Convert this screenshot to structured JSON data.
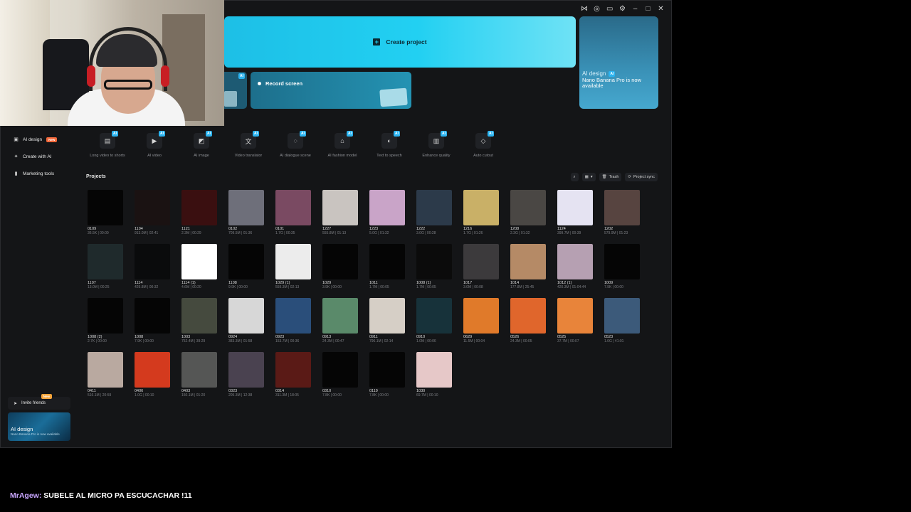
{
  "window_controls": [
    "share-icon",
    "target-icon",
    "screen-icon",
    "settings-icon",
    "minimize-icon",
    "maximize-icon",
    "close-icon"
  ],
  "hero": {
    "create_project": "Create project",
    "record_screen": "Record screen",
    "side_title": "AI design",
    "side_tag": "AI",
    "side_subtitle": "Nano Banana Pro is now available",
    "small_card_tag": "AI"
  },
  "sidebar": {
    "items": [
      {
        "label": "AI design",
        "badge": "New",
        "icon": "image-icon"
      },
      {
        "label": "Create with AI",
        "icon": "sparkle-icon"
      },
      {
        "label": "Marketing tools",
        "icon": "phone-icon"
      }
    ],
    "invite_label": "Invite friends",
    "invite_badge": "New",
    "promo_title": "AI design",
    "promo_sub": "Nano Banana Pro is now available"
  },
  "tools": [
    {
      "label": "Long video to shorts",
      "tag": "AI",
      "icon": "film-icon"
    },
    {
      "label": "AI video",
      "tag": "AI",
      "icon": "video-play-icon"
    },
    {
      "label": "AI image",
      "tag": "AI",
      "icon": "image-add-icon"
    },
    {
      "label": "Video translator",
      "tag": "AI",
      "icon": "translate-icon"
    },
    {
      "label": "AI dialogue scene",
      "tag": "AI",
      "icon": "dialogue-icon"
    },
    {
      "label": "AI fashion model",
      "tag": "AI",
      "icon": "shirt-icon"
    },
    {
      "label": "Text to speech",
      "tag": "AI",
      "icon": "speech-icon"
    },
    {
      "label": "Enhance quality",
      "tag": "AI",
      "icon": "enhance-icon"
    },
    {
      "label": "Auto cutout",
      "tag": "AI",
      "icon": "eraser-icon"
    }
  ],
  "projects": {
    "title": "Projects",
    "trash_label": "Trash",
    "sync_label": "Project sync",
    "items": [
      {
        "name": "0109",
        "meta": "36.5K | 00:00",
        "color": "#050505"
      },
      {
        "name": "1104",
        "meta": "913.0M | 02:41",
        "color": "#1a1212"
      },
      {
        "name": "1121",
        "meta": "2.3M | 00:29",
        "color": "#3a0f10"
      },
      {
        "name": "0102",
        "meta": "709.5M | 01:36",
        "color": "#6e6f7a"
      },
      {
        "name": "0101",
        "meta": "1.7G | 00:35",
        "color": "#7a4a62"
      },
      {
        "name": "1227",
        "meta": "555.8M | 01:13",
        "color": "#c9c4c0"
      },
      {
        "name": "1223",
        "meta": "5.0G | 01:32",
        "color": "#c9a4c8"
      },
      {
        "name": "1222",
        "meta": "3.0G | 00:28",
        "color": "#2c3a4a"
      },
      {
        "name": "1216",
        "meta": "1.7G | 01:26",
        "color": "#c9b067"
      },
      {
        "name": "1208",
        "meta": "2.3G | 01:32",
        "color": "#4a4744"
      },
      {
        "name": "1124",
        "meta": "399.7M | 00:39",
        "color": "#e5e3f2"
      },
      {
        "name": "1202",
        "meta": "579.9M | 01:23",
        "color": "#574440"
      },
      {
        "name": "1107",
        "meta": "13.0M | 00:25",
        "color": "#1f2a2c"
      },
      {
        "name": "1114",
        "meta": "429.8M | 00:32",
        "color": "#0a0b0c"
      },
      {
        "name": "1114 (1)",
        "meta": "4.6M | 00:20",
        "color": "#ffffff"
      },
      {
        "name": "1108",
        "meta": "9.9K | 00:00",
        "color": "#050505"
      },
      {
        "name": "1029 (1)",
        "meta": "559.3M | 02:13",
        "color": "#ececec"
      },
      {
        "name": "1029",
        "meta": "3.9K | 00:00",
        "color": "#050505"
      },
      {
        "name": "1011",
        "meta": "1.7M | 00:05",
        "color": "#050505"
      },
      {
        "name": "1008 (1)",
        "meta": "1.7M | 00:05",
        "color": "#0b0b0b"
      },
      {
        "name": "1017",
        "meta": "3.0M | 00:08",
        "color": "#3c3a3c"
      },
      {
        "name": "1014",
        "meta": "177.8M | 25:45",
        "color": "#b58a66"
      },
      {
        "name": "1012 (1)",
        "meta": "420.3M | 01:04:44",
        "color": "#b6a0b2"
      },
      {
        "name": "1009",
        "meta": "7.9K | 00:00",
        "color": "#050505"
      },
      {
        "name": "1008 (2)",
        "meta": "2.7K | 00:00",
        "color": "#050505"
      },
      {
        "name": "1008",
        "meta": "7.9K | 00:00",
        "color": "#050505"
      },
      {
        "name": "1003",
        "meta": "752.4M | 39:29",
        "color": "#454a3e"
      },
      {
        "name": "0924",
        "meta": "383.3M | 01:58",
        "color": "#d7d7d7"
      },
      {
        "name": "0923",
        "meta": "153.7M | 00:36",
        "color": "#2a4e7a"
      },
      {
        "name": "0913",
        "meta": "24.3M | 00:47",
        "color": "#5a8a6a"
      },
      {
        "name": "0911",
        "meta": "796.1M | 02:14",
        "color": "#d6cfc6"
      },
      {
        "name": "0910",
        "meta": "1.0M | 00:06",
        "color": "#17323a"
      },
      {
        "name": "0629",
        "meta": "11.5M | 00:04",
        "color": "#e07a2a"
      },
      {
        "name": "0526",
        "meta": "24.3M | 00:05",
        "color": "#e0662c"
      },
      {
        "name": "0525",
        "meta": "37.7M | 00:07",
        "color": "#e8843a"
      },
      {
        "name": "0523",
        "meta": "1.0G | 41:01",
        "color": "#3c5a7a"
      },
      {
        "name": "0411",
        "meta": "516.1M | 20:59",
        "color": "#b9a9a0"
      },
      {
        "name": "0406",
        "meta": "1.0G | 00:10",
        "color": "#d43a1e"
      },
      {
        "name": "0403",
        "meta": "150.1M | 01:20",
        "color": "#555655"
      },
      {
        "name": "0323",
        "meta": "205.3M | 12:38",
        "color": "#4a4250"
      },
      {
        "name": "0314",
        "meta": "311.3M | 18:05",
        "color": "#5a1a16"
      },
      {
        "name": "0310",
        "meta": "7.8K | 00:00",
        "color": "#050505"
      },
      {
        "name": "0119",
        "meta": "7.8K | 00:00",
        "color": "#050505"
      },
      {
        "name": "1030",
        "meta": "69.7M | 00:10",
        "color": "#e6c8c8"
      }
    ]
  },
  "chat": {
    "user": "MrAgew:",
    "message": "SUBELE AL MICRO PA ESCUCACHAR !11"
  }
}
